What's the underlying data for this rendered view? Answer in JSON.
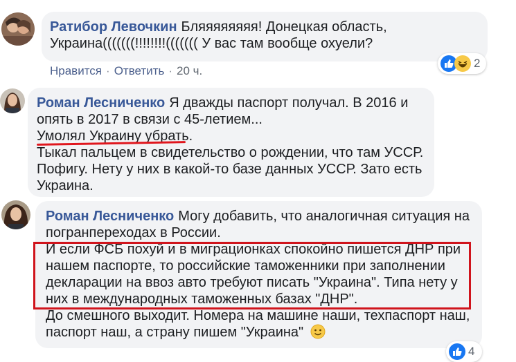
{
  "comments": [
    {
      "author": "Ратибор Левочкин",
      "lines": [
        "Бляяяяяяяя! Донецкая область,",
        "Украина(((((((!!!!!!!!((((((( У вас там вообще охуели?"
      ],
      "actions": {
        "like": "Нравится",
        "reply": "Ответить",
        "time": "20 ч."
      },
      "reactions": {
        "icons": [
          "like-icon",
          "haha-icon"
        ],
        "count": "2"
      }
    },
    {
      "author": "Роман Лесниченко",
      "lines": [
        "Я дважды паспорт получал. В 2016 и",
        "опять в 2017 в связи с 45-летием...",
        "Умолял Украину убрать.",
        "Тыкал пальцем в свидетельство о рождении, что там УССР.",
        "Пофигу. Нету у них в какой-то базе данных УССР. Зато есть",
        "Украина."
      ]
    },
    {
      "author": "Роман Лесниченко",
      "lines": [
        "Могу добавить, что аналогичная ситуация на",
        "погранпереходах в России.",
        "И если ФСБ похуй и в миграционках спокойно пишется ДНР при",
        "нашем паспорте, то российские таможенники при заполнении",
        "декларации на ввоз авто требуют писать \"Украина\". Типа нету у",
        "них в международных таможенных базах \"ДНР\".",
        "До смешного выходит. Номера на машине наши, техпаспорт наш,",
        "паспорт наш, а страну пишем \"Украина\""
      ],
      "emoji": "slightly-smiling-face-icon",
      "reactions": {
        "icons": [
          "like-icon"
        ],
        "count": "4"
      }
    }
  ],
  "colors": {
    "author": "#385898",
    "bubble": "#f2f3f5",
    "annotation_red": "#d0141c",
    "like_blue": "#1877f2",
    "haha_yellow": "#f7c948"
  }
}
